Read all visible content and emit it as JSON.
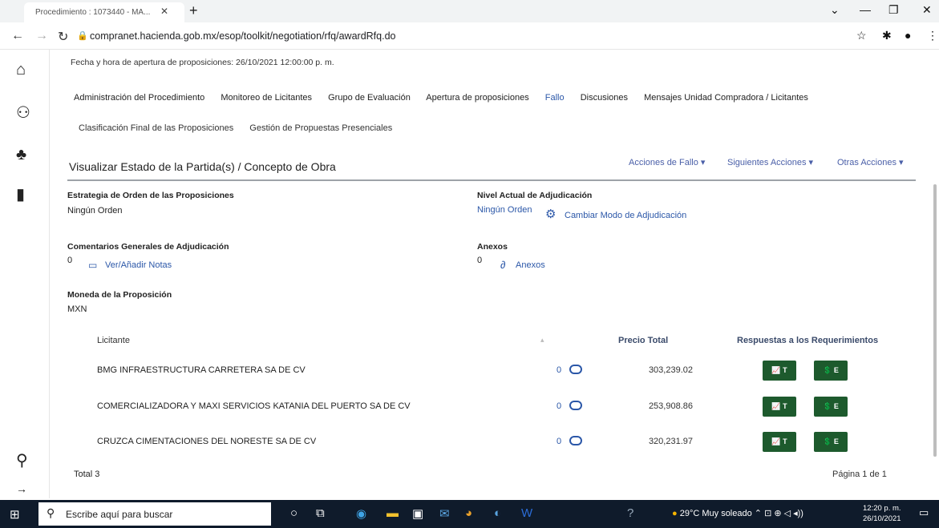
{
  "browser": {
    "tab_title": "Procedimiento : 1073440 - MA...",
    "tab_close": "✕",
    "new_tab": "+",
    "url": "compranet.hacienda.gob.mx/esop/toolkit/negotiation/rfq/awardRfq.do",
    "win_controls": [
      "⌄",
      "—",
      "❐",
      "✕"
    ]
  },
  "page": {
    "apertura": "Fecha y hora de apertura de proposiciones: 26/10/2021 12:00:00 p. m.",
    "nav_primary": [
      "Administración del Procedimiento",
      "Monitoreo de Licitantes",
      "Grupo de Evaluación",
      "Apertura de proposiciones",
      "Fallo",
      "Discusiones",
      "Mensajes Unidad Compradora / Licitantes"
    ],
    "nav_secondary": [
      "Clasificación Final de las Proposiciones",
      "Gestión de Propuestas Presenciales"
    ],
    "section_title": "Visualizar Estado de la Partida(s) / Concepto de Obra",
    "actions": {
      "fallo": "Acciones de Fallo ▾",
      "siguientes": "Siguientes Acciones ▾",
      "otras": "Otras Acciones ▾"
    },
    "estrategia_label": "Estrategia de Orden de las Proposiciones",
    "estrategia_value": "Ningún Orden",
    "nivel_label": "Nivel Actual de Adjudicación",
    "nivel_value": "Ningún Orden",
    "cambiar_modo": "Cambiar Modo de Adjudicación",
    "comentarios_label": "Comentarios Generales de Adjudicación",
    "comentarios_count": "0",
    "ver_notas": "Ver/Añadir Notas",
    "anexos_label": "Anexos",
    "anexos_count": "0",
    "anexos_link": "Anexos",
    "moneda_label": "Moneda de la Proposición",
    "moneda_value": "MXN"
  },
  "table": {
    "headers": {
      "licitante": "Licitante",
      "precio": "Precio Total",
      "respuestas": "Respuestas a los Requerimientos"
    },
    "rows": [
      {
        "name": "BMG INFRAESTRUCTURA CARRETERA SA DE CV",
        "count": "0",
        "price": "303,239.02",
        "btn_t": "T",
        "btn_e": "E"
      },
      {
        "name": "COMERCIALIZADORA Y MAXI SERVICIOS KATANIA DEL PUERTO SA DE CV",
        "count": "0",
        "price": "253,908.86",
        "btn_t": "T",
        "btn_e": "E"
      },
      {
        "name": "CRUZCA CIMENTACIONES DEL NORESTE SA DE CV",
        "count": "0",
        "price": "320,231.97",
        "btn_t": "T",
        "btn_e": "E"
      }
    ],
    "total": "Total 3",
    "pagination": "Página 1 de 1"
  },
  "taskbar": {
    "search_placeholder": "Escribe aquí para buscar",
    "weather": "29°C  Muy soleado",
    "time": "12:20 p. m.",
    "date": "26/10/2021"
  }
}
